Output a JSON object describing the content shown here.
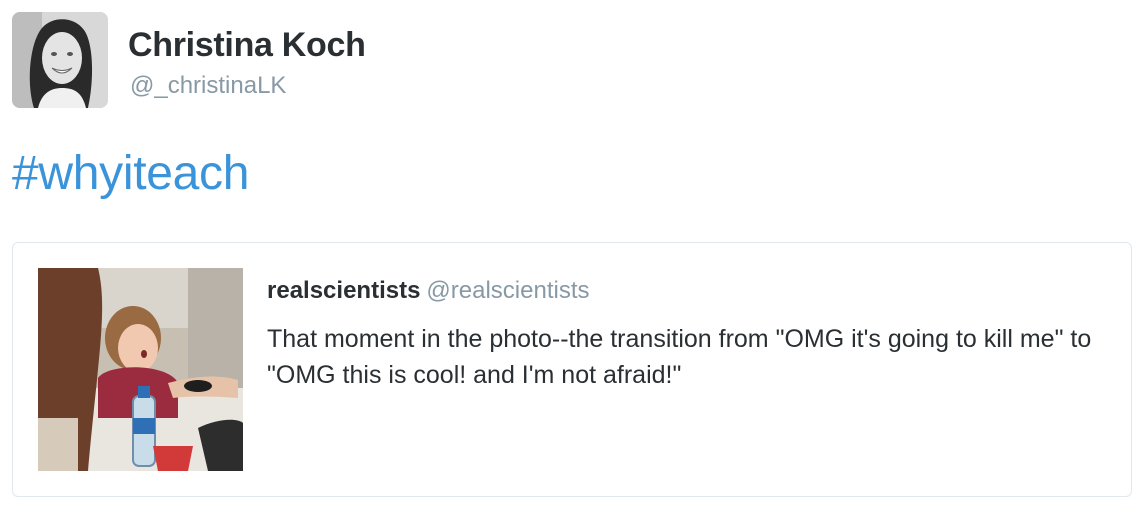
{
  "author": {
    "name": "Christina Koch",
    "handle": "@_christinaLK"
  },
  "tweet": {
    "hashtag": "#whyiteach"
  },
  "quoted": {
    "name": "realscientists",
    "handle": "@realscientists",
    "text": "That moment in the photo--the transition from \"OMG it's going to kill me\" to \"OMG this is cool! and I'm not afraid!\""
  },
  "colors": {
    "link": "#3b94d9",
    "text": "#292f33",
    "muted": "#8899a6",
    "border": "#e1e8ed"
  }
}
